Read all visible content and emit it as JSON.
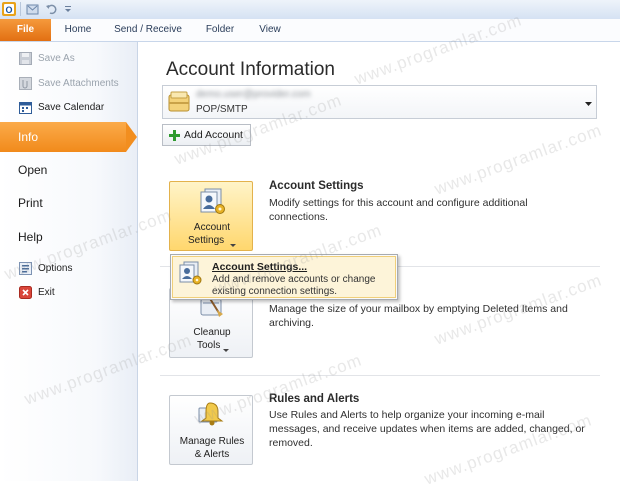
{
  "ribbon": {
    "tabs": [
      "File",
      "Home",
      "Send / Receive",
      "Folder",
      "View"
    ]
  },
  "backstage": {
    "commands": [
      {
        "label": "Save As",
        "enabled": false
      },
      {
        "label": "Save Attachments",
        "enabled": false
      },
      {
        "label": "Save Calendar",
        "enabled": true
      }
    ],
    "nav": [
      "Info",
      "Open",
      "Print",
      "Help"
    ],
    "bottom_commands": [
      "Options",
      "Exit"
    ]
  },
  "main": {
    "title": "Account Information",
    "account": {
      "name": "demo.user@provider.com",
      "type": "POP/SMTP"
    },
    "add_account_label": "Add Account",
    "sections": [
      {
        "btn_line1": "Account",
        "btn_line2": "Settings",
        "title": "Account Settings",
        "desc": "Modify settings for this account and configure additional connections."
      },
      {
        "btn_line1": "Cleanup",
        "btn_line2": "Tools",
        "title": "",
        "desc": "Manage the size of your mailbox by emptying Deleted Items and archiving."
      },
      {
        "btn_line1": "Manage Rules",
        "btn_line2": "& Alerts",
        "title": "Rules and Alerts",
        "desc": "Use Rules and Alerts to help organize your incoming e-mail messages, and receive updates when items are added, changed, or removed."
      }
    ]
  },
  "menu": {
    "title": "Account Settings...",
    "desc": "Add and remove accounts or change existing connection settings."
  },
  "watermark": "www.programlar.com",
  "colors": {
    "file_tab": "#e8771a",
    "selected_nav": "#f29427",
    "hot_button": "#ffd76e"
  }
}
